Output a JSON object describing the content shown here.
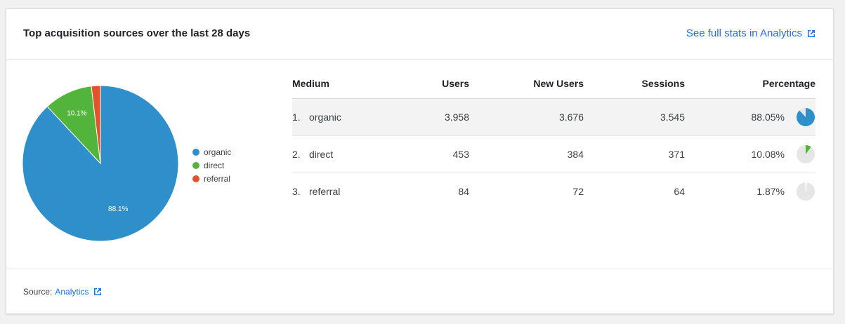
{
  "card": {
    "title": "Top acquisition sources over the last 28 days",
    "header_link": "See full stats in Analytics",
    "footer_source_label": "Source:",
    "footer_source_link": "Analytics"
  },
  "colors": {
    "organic": "#2e8fca",
    "direct": "#52b43a",
    "referral": "#e2532c",
    "link": "#1a73e8",
    "mini_pie_bg": "#e6e6e6"
  },
  "legend": [
    "organic",
    "direct",
    "referral"
  ],
  "table": {
    "headers": [
      "Medium",
      "Users",
      "New Users",
      "Sessions",
      "Percentage"
    ],
    "rows": [
      {
        "rank": "1.",
        "medium": "organic",
        "users": "3.958",
        "new_users": "3.676",
        "sessions": "3.545",
        "percentage": "88.05%",
        "fraction": 0.8805
      },
      {
        "rank": "2.",
        "medium": "direct",
        "users": "453",
        "new_users": "384",
        "sessions": "371",
        "percentage": "10.08%",
        "fraction": 0.1008
      },
      {
        "rank": "3.",
        "medium": "referral",
        "users": "84",
        "new_users": "72",
        "sessions": "64",
        "percentage": "1.87%",
        "fraction": 0.0187
      }
    ]
  },
  "chart_data": {
    "type": "pie",
    "categories": [
      "organic",
      "direct",
      "referral"
    ],
    "values": [
      88.05,
      10.08,
      1.87
    ],
    "data_labels": [
      "88.1%",
      "10.1%",
      ""
    ],
    "legend_position": "right"
  }
}
